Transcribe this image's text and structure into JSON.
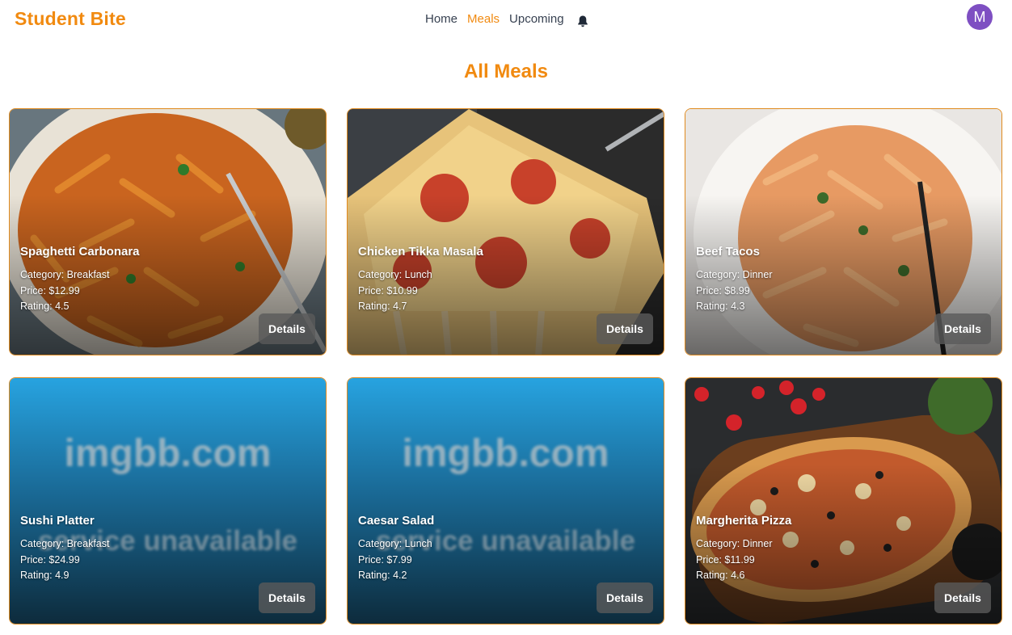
{
  "nav": {
    "brand": "Student Bite",
    "links": [
      "Home",
      "Meals",
      "Upcoming"
    ],
    "active": "Meals",
    "bell_icon": "bell-icon",
    "avatar_initial": "M"
  },
  "page": {
    "title": "All Meals"
  },
  "meals": [
    {
      "name": "Spaghetti Carbonara",
      "category": "Category: Breakfast",
      "price": "Price: $12.99",
      "rating": "Rating: 4.5",
      "button": "Details",
      "image": "pasta"
    },
    {
      "name": "Chicken Tikka Masala",
      "category": "Category: Lunch",
      "price": "Price: $10.99",
      "rating": "Rating: 4.7",
      "button": "Details",
      "image": "pizza-slice"
    },
    {
      "name": "Beef Tacos",
      "category": "Category: Dinner",
      "price": "Price: $8.99",
      "rating": "Rating: 4.3",
      "button": "Details",
      "image": "pasta-light"
    },
    {
      "name": "Sushi Platter",
      "category": "Category: Breakfast",
      "price": "Price: $24.99",
      "rating": "Rating: 4.9",
      "button": "Details",
      "image": "placeholder",
      "placeholder_line1": "imgbb.com",
      "placeholder_line2": "service unavailable"
    },
    {
      "name": "Caesar Salad",
      "category": "Category: Lunch",
      "price": "Price: $7.99",
      "rating": "Rating: 4.2",
      "button": "Details",
      "image": "placeholder",
      "placeholder_line1": "imgbb.com",
      "placeholder_line2": "service unavailable"
    },
    {
      "name": "Margherita Pizza",
      "category": "Category: Dinner",
      "price": "Price: $11.99",
      "rating": "Rating: 4.6",
      "button": "Details",
      "image": "pizza-board"
    }
  ],
  "colors": {
    "accent": "#f18a10",
    "avatar": "#7e4fc2",
    "card_border": "#e08a1e"
  }
}
